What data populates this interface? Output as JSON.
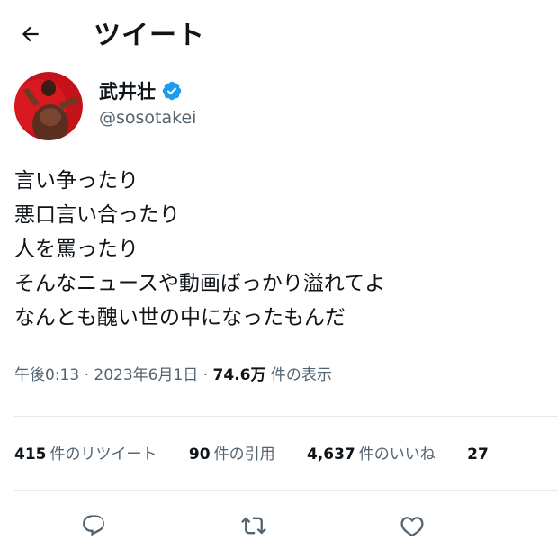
{
  "header": {
    "title": "ツイート"
  },
  "author": {
    "display_name": "武井壮",
    "handle": "@sosotakei"
  },
  "tweet": {
    "lines": [
      "言い争ったり",
      "悪口言い合ったり",
      "人を罵ったり",
      "そんなニュースや動画ばっかり溢れてよ",
      "なんとも醜い世の中になったもんだ"
    ]
  },
  "meta": {
    "time": "午後0:13",
    "separator": "·",
    "date": "2023年6月1日",
    "views_count": "74.6万",
    "views_label": "件の表示"
  },
  "stats": [
    {
      "count": "415",
      "label": "件のリツイート"
    },
    {
      "count": "90",
      "label": "件の引用"
    },
    {
      "count": "4,637",
      "label": "件のいいね"
    },
    {
      "count": "27",
      "label": ""
    }
  ],
  "icons": {
    "back": "arrow-left-icon",
    "verified": "verified-badge-icon",
    "reply": "reply-icon",
    "retweet": "retweet-icon",
    "like": "heart-icon"
  },
  "colors": {
    "verified": "#1d9bf0",
    "text": "#0f1419",
    "secondary": "#536471"
  }
}
